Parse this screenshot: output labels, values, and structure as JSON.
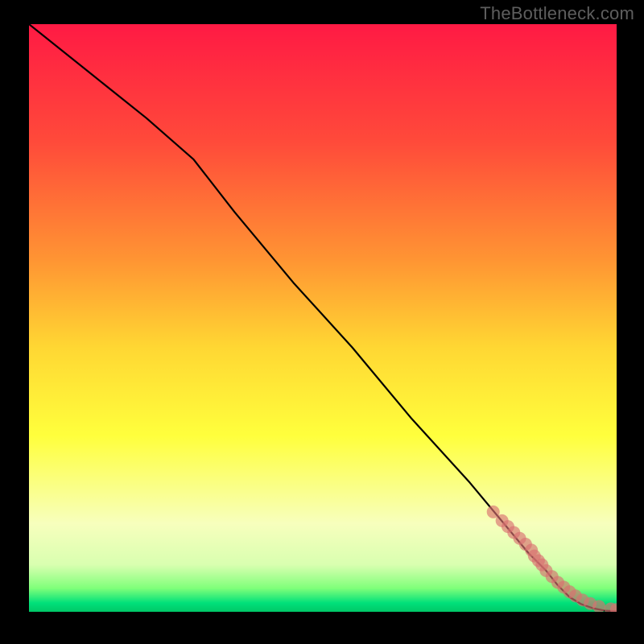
{
  "watermark": "TheBottleneck.com",
  "chart_data": {
    "type": "line",
    "title": "",
    "xlabel": "",
    "ylabel": "",
    "xlim": [
      0,
      100
    ],
    "ylim": [
      0,
      100
    ],
    "grid": false,
    "legend": false,
    "background_gradient": {
      "stops": [
        {
          "offset": 0.0,
          "color": "#ff1a44"
        },
        {
          "offset": 0.2,
          "color": "#ff4a3a"
        },
        {
          "offset": 0.4,
          "color": "#ff9433"
        },
        {
          "offset": 0.55,
          "color": "#ffd733"
        },
        {
          "offset": 0.7,
          "color": "#ffff3c"
        },
        {
          "offset": 0.85,
          "color": "#f7ffbd"
        },
        {
          "offset": 0.92,
          "color": "#d9ffb0"
        },
        {
          "offset": 0.96,
          "color": "#7fff7a"
        },
        {
          "offset": 0.985,
          "color": "#00e07a"
        },
        {
          "offset": 1.0,
          "color": "#00c867"
        }
      ]
    },
    "series": [
      {
        "name": "curve",
        "color": "#000000",
        "x": [
          0,
          10,
          20,
          28,
          35,
          45,
          55,
          65,
          75,
          85,
          88,
          90,
          92,
          94,
          96,
          98,
          100
        ],
        "y": [
          100,
          92,
          84,
          77,
          68,
          56,
          45,
          33,
          22,
          10,
          7,
          4.5,
          2.5,
          1.3,
          0.6,
          0.2,
          0.1
        ]
      }
    ],
    "scatter": {
      "name": "markers",
      "color": "#d97070",
      "radius": 8,
      "x": [
        79,
        80.5,
        81.5,
        82.5,
        83.5,
        84.5,
        85.5,
        86,
        86.7,
        87.3,
        88,
        89,
        90,
        91,
        92,
        93,
        94.2,
        95.5,
        97,
        99,
        100
      ],
      "y": [
        17,
        15.5,
        14.5,
        13.5,
        12.5,
        11.5,
        10.5,
        9.5,
        8.7,
        8.0,
        7.0,
        6.0,
        5.0,
        4.2,
        3.4,
        2.7,
        2.0,
        1.4,
        0.9,
        0.5,
        0.4
      ]
    }
  }
}
